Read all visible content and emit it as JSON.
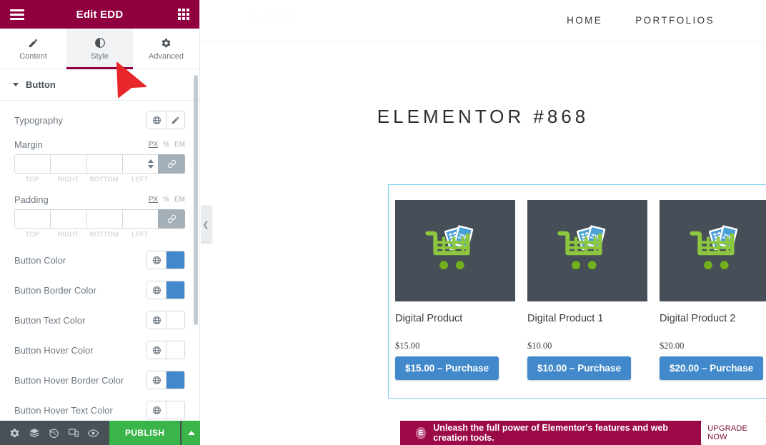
{
  "panel": {
    "title": "Edit EDD",
    "menu_icon": "hamburger-icon",
    "apps_icon": "grid-icon",
    "tabs": [
      {
        "label": "Content",
        "icon": "pencil-icon",
        "active": false
      },
      {
        "label": "Style",
        "icon": "contrast-icon",
        "active": true
      },
      {
        "label": "Advanced",
        "icon": "gear-icon",
        "active": false
      }
    ],
    "section": {
      "label": "Button",
      "expanded": true
    },
    "controls": {
      "typography": {
        "label": "Typography",
        "globe": "globe-icon",
        "edit": "pencil-icon"
      },
      "margin": {
        "label": "Margin",
        "units": [
          "PX",
          "%",
          "EM"
        ],
        "selected_unit": "PX",
        "values": [
          "",
          "",
          "",
          ""
        ],
        "sides": [
          "TOP",
          "RIGHT",
          "BOTTOM",
          "LEFT"
        ],
        "linked": true
      },
      "padding": {
        "label": "Padding",
        "units": [
          "PX",
          "%",
          "EM"
        ],
        "selected_unit": "PX",
        "values": [
          "",
          "",
          "",
          ""
        ],
        "sides": [
          "TOP",
          "RIGHT",
          "BOTTOM",
          "LEFT"
        ],
        "linked": true
      },
      "colors": [
        {
          "label": "Button Color",
          "value": "#4189ca"
        },
        {
          "label": "Button Border Color",
          "value": "#4189ca"
        },
        {
          "label": "Button Text Color",
          "value": "#ffffff"
        },
        {
          "label": "Button Hover Color",
          "value": "#ffffff"
        },
        {
          "label": "Button Hover Border Color",
          "value": "#4189ca"
        },
        {
          "label": "Button Hover Text Color",
          "value": "#ffffff"
        }
      ]
    },
    "footer": {
      "icons": [
        "settings-icon",
        "layers-icon",
        "history-icon",
        "responsive-icon",
        "preview-icon"
      ],
      "publish_label": "PUBLISH",
      "publish_color": "#39b54a"
    }
  },
  "preview": {
    "logo": "RASEL",
    "nav": [
      "HOME",
      "PORTFOLIOS"
    ],
    "page_title": "ELEMENTOR #868",
    "collapse_icon": "chevron-left-icon",
    "selection_color": "#79d0f2",
    "products": [
      {
        "name": "Digital Product",
        "price": "$15.00",
        "button": "$15.00 – Purchase"
      },
      {
        "name": "Digital Product 1",
        "price": "$10.00",
        "button": "$10.00 – Purchase"
      },
      {
        "name": "Digital Product 2",
        "price": "$20.00",
        "button": "$20.00 – Purchase"
      }
    ]
  },
  "promo": {
    "badge": "E",
    "text": "Unleash the full power of Elementor's features and web creation tools.",
    "button": "UPGRADE NOW",
    "background": "#9b0a46"
  }
}
